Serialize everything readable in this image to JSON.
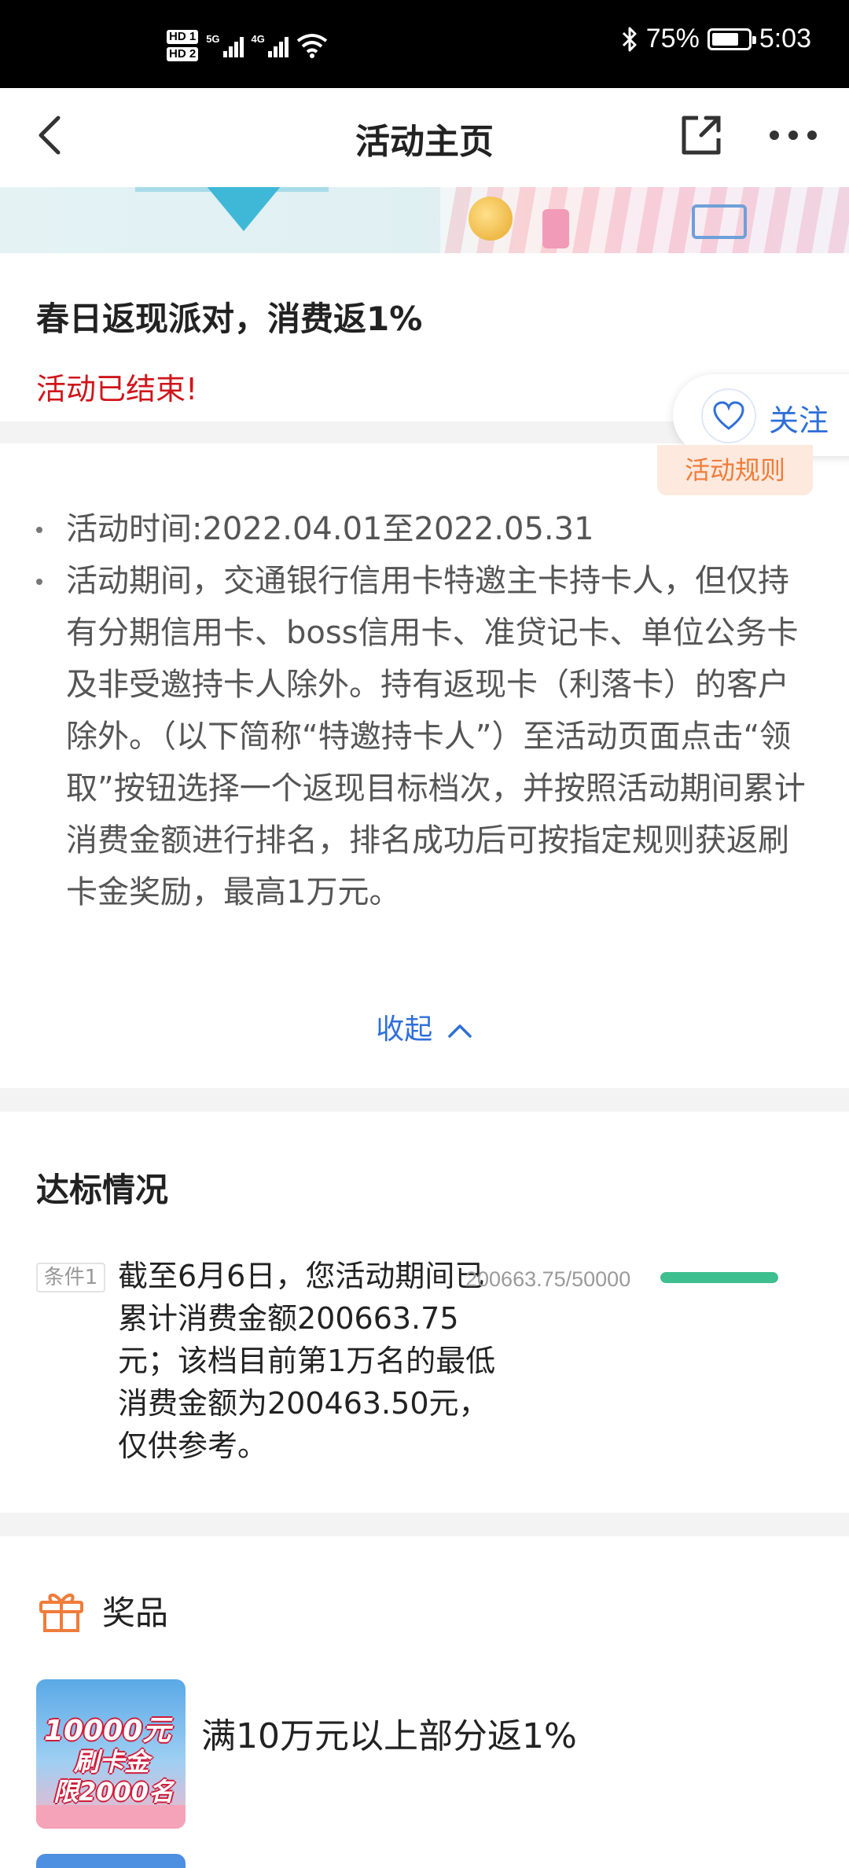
{
  "status_bar": {
    "hd1": "HD 1",
    "hd2": "HD 2",
    "net1": "5G",
    "net2": "4G",
    "battery_percent": "75%",
    "battery_level": 0.75,
    "time": "5:03"
  },
  "nav": {
    "title": "活动主页",
    "back_icon": "chevron-left-icon",
    "share_icon": "share-icon",
    "more_icon": "more-dots-icon"
  },
  "activity": {
    "title": "春日返现派对，消费返1%",
    "status": "活动已结束!",
    "follow_label": "关注",
    "rules_button": "活动规则",
    "rules": [
      "活动时间:2022.04.01至2022.05.31",
      "活动期间，交通银行信用卡特邀主卡持卡人，但仅持有分期信用卡、boss信用卡、准贷记卡、单位公务卡及非受邀持卡人除外。持有返现卡（利落卡）的客户除外。（以下简称“特邀持卡人”）至活动页面点击“领取”按钮选择一个返现目标档次，并按照活动期间累计消费金额进行排名，排名成功后可按指定规则获返刷卡金奖励，最高1万元。"
    ],
    "collapse_label": "收起"
  },
  "compliance": {
    "title": "达标情况",
    "condition_tag": "条件1",
    "condition_text": "截至6月6日，您活动期间已累计消费金额200663.75元；该档目前第1万名的最低消费金额为200463.50元，仅供参考。",
    "progress_text": "200663.75/50000",
    "progress_fraction": 1.0
  },
  "prizes": {
    "title": "奖品",
    "items": [
      {
        "image_line1": "10000元",
        "image_line2": "刷卡金",
        "image_line3": "限2000名",
        "label": "满10万元以上部分返1%"
      }
    ]
  },
  "colors": {
    "accent_blue": "#2f6fd9",
    "ended_red": "#d0151b",
    "rules_orange": "#f07c3a",
    "progress_green": "#3dbf8f"
  }
}
